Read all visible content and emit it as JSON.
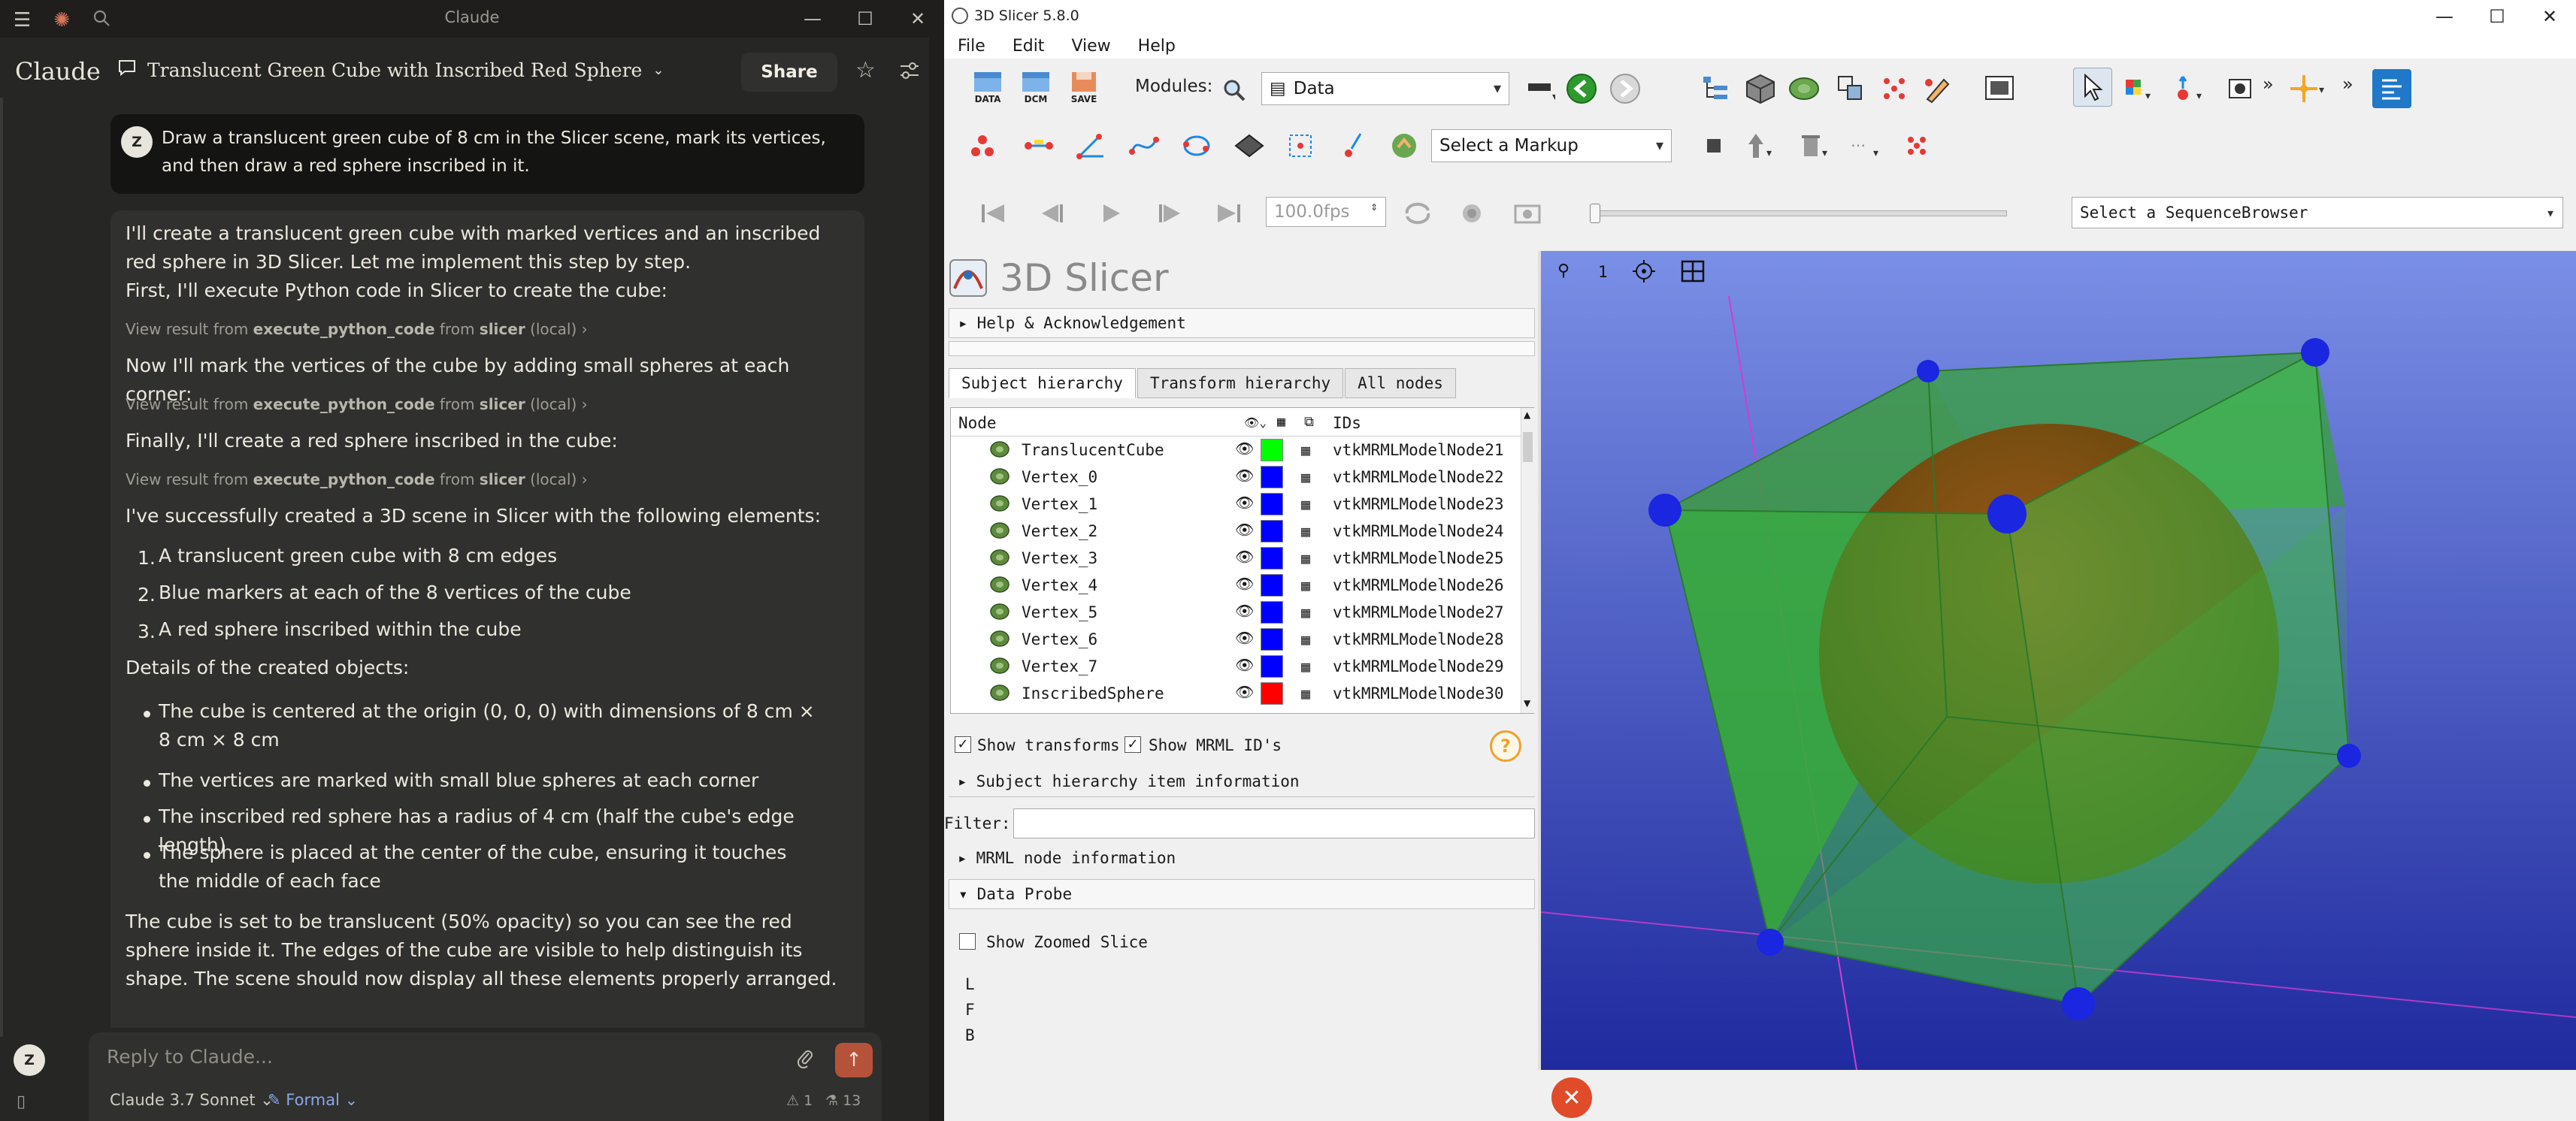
{
  "claude": {
    "app_title": "Claude",
    "logo": "Claude",
    "conversation_title": "Translucent Green Cube with Inscribed Red Sphere",
    "share_label": "Share",
    "user_initial": "Z",
    "user_message": "Draw a translucent green cube of 8 cm in the Slicer scene, mark its vertices, and then draw a red sphere inscribed in it.",
    "assistant": {
      "intro": "I'll create a translucent green cube with marked vertices and an inscribed red sphere in 3D Slicer. Let me implement this step by step.",
      "step1": "First, I'll execute Python code in Slicer to create the cube:",
      "step2": "Now I'll mark the vertices of the cube by adding small spheres at each corner:",
      "step3": "Finally, I'll create a red sphere inscribed in the cube:",
      "tool_prefix": "View result from",
      "tool_name": "execute_python_code",
      "tool_from": "from",
      "tool_server": "slicer",
      "tool_suffix": "(local)",
      "summary": "I've successfully created a 3D scene in Slicer with the following elements:",
      "list": [
        {
          "num": "1.",
          "text": "A translucent green cube with 8 cm edges"
        },
        {
          "num": "2.",
          "text": "Blue markers at each of the 8 vertices of the cube"
        },
        {
          "num": "3.",
          "text": "A red sphere inscribed within the cube"
        }
      ],
      "details_heading": "Details of the created objects:",
      "bullets": [
        "The cube is centered at the origin (0, 0, 0) with dimensions of 8 cm × 8 cm × 8 cm",
        "The vertices are marked with small blue spheres at each corner",
        "The inscribed red sphere has a radius of 4 cm (half the cube's edge length)",
        "The sphere is placed at the center of the cube, ensuring it touches the middle of each face"
      ],
      "closing": "The cube is set to be translucent (50% opacity) so you can see the red sphere inside it. The edges of the cube are visible to help distinguish its shape. The scene should now display all these elements properly arranged."
    },
    "composer": {
      "placeholder": "Reply to Claude...",
      "model": "Claude 3.7 Sonnet",
      "style": "Formal",
      "count1": "1",
      "count2": "13"
    },
    "sidebar_initial": "Z"
  },
  "slicer": {
    "window_title": "3D Slicer 5.8.0",
    "menu": [
      "File",
      "Edit",
      "View",
      "Help"
    ],
    "modules_label": "Modules:",
    "module_value": "Data",
    "markup_placeholder": "Select a Markup",
    "fps_value": "100.0fps",
    "sequence_placeholder": "Select a SequenceBrowser",
    "logo_text": "3D Slicer",
    "help_section": "Help & Acknowledgement",
    "tabs": [
      "Subject hierarchy",
      "Transform hierarchy",
      "All nodes"
    ],
    "tree_headers": {
      "node": "Node",
      "ids": "IDs"
    },
    "nodes": [
      {
        "name": "TranslucentCube",
        "color": "#00ff00",
        "id": "vtkMRMLModelNode21"
      },
      {
        "name": "Vertex_0",
        "color": "#0000ff",
        "id": "vtkMRMLModelNode22"
      },
      {
        "name": "Vertex_1",
        "color": "#0000ff",
        "id": "vtkMRMLModelNode23"
      },
      {
        "name": "Vertex_2",
        "color": "#0000ff",
        "id": "vtkMRMLModelNode24"
      },
      {
        "name": "Vertex_3",
        "color": "#0000ff",
        "id": "vtkMRMLModelNode25"
      },
      {
        "name": "Vertex_4",
        "color": "#0000ff",
        "id": "vtkMRMLModelNode26"
      },
      {
        "name": "Vertex_5",
        "color": "#0000ff",
        "id": "vtkMRMLModelNode27"
      },
      {
        "name": "Vertex_6",
        "color": "#0000ff",
        "id": "vtkMRMLModelNode28"
      },
      {
        "name": "Vertex_7",
        "color": "#0000ff",
        "id": "vtkMRMLModelNode29"
      },
      {
        "name": "InscribedSphere",
        "color": "#ff0000",
        "id": "vtkMRMLModelNode30"
      }
    ],
    "show_transforms": "Show transforms",
    "show_mrml_ids": "Show MRML ID's",
    "item_info": "Subject hierarchy item information",
    "filter_label": "Filter:",
    "mrml_info": "MRML node information",
    "data_probe": "Data Probe",
    "show_zoomed": "Show Zoomed Slice",
    "probe_lines": [
      "L",
      "F",
      "B"
    ],
    "view_number": "1",
    "help_symbol": "?",
    "close_symbol": "✕"
  }
}
